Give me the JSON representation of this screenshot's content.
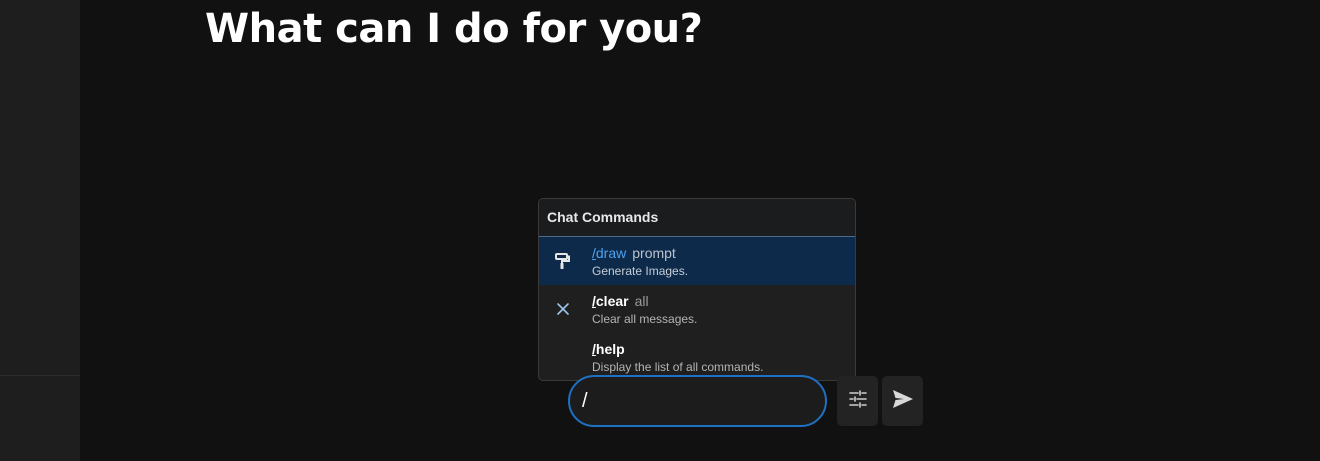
{
  "page": {
    "title": "What can I do for you?"
  },
  "commands_popup": {
    "header": "Chat Commands",
    "items": [
      {
        "slash": "/",
        "name": "draw",
        "arg": "prompt",
        "description": "Generate Images.",
        "icon": "paint-roller-icon",
        "active": true
      },
      {
        "slash": "/",
        "name": "clear",
        "arg": "all",
        "description": "Clear all messages.",
        "icon": "close-icon",
        "active": false
      },
      {
        "slash": "/",
        "name": "help",
        "arg": "",
        "description": "Display the list of all commands.",
        "icon": "",
        "active": false
      }
    ]
  },
  "chat_input": {
    "value": "/"
  },
  "toolbar": {
    "settings_icon": "sliders-icon",
    "send_icon": "send-icon"
  },
  "colors": {
    "background": "#111111",
    "sidebar": "#1e1e1e",
    "accent": "#1f6fc2",
    "active_item": "#0d2a4a",
    "active_text": "#4da3f0"
  }
}
